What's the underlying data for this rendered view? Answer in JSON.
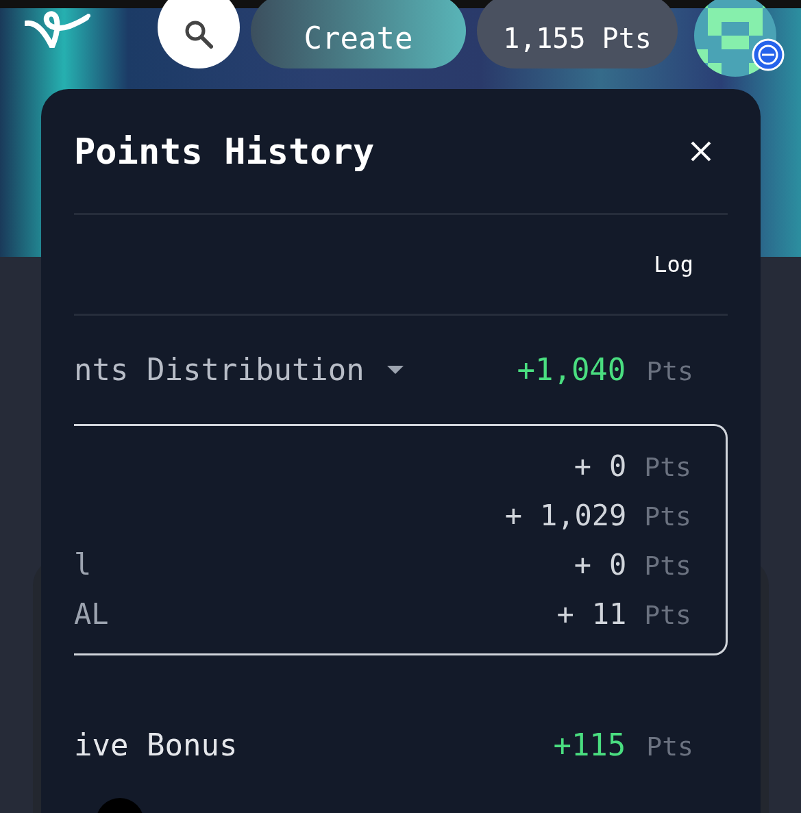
{
  "header": {
    "create_button": "Create",
    "points": "1,155 Pts"
  },
  "modal": {
    "title": "Points History",
    "tab": "Log",
    "entries": [
      {
        "label": "nts Distribution",
        "amount": "+1,040",
        "unit": "Pts",
        "expanded": true,
        "breakdown": [
          {
            "sign": "+",
            "amount": "0",
            "unit": "Pts"
          },
          {
            "sign": "+",
            "amount": "1,029",
            "unit": "Pts"
          },
          {
            "label": "l",
            "sign": "+",
            "amount": "0",
            "unit": "Pts"
          },
          {
            "label": "AL",
            "sign": "+",
            "amount": "11",
            "unit": "Pts"
          }
        ]
      },
      {
        "label": "ive Bonus",
        "amount": "+115",
        "unit": "Pts"
      }
    ]
  }
}
